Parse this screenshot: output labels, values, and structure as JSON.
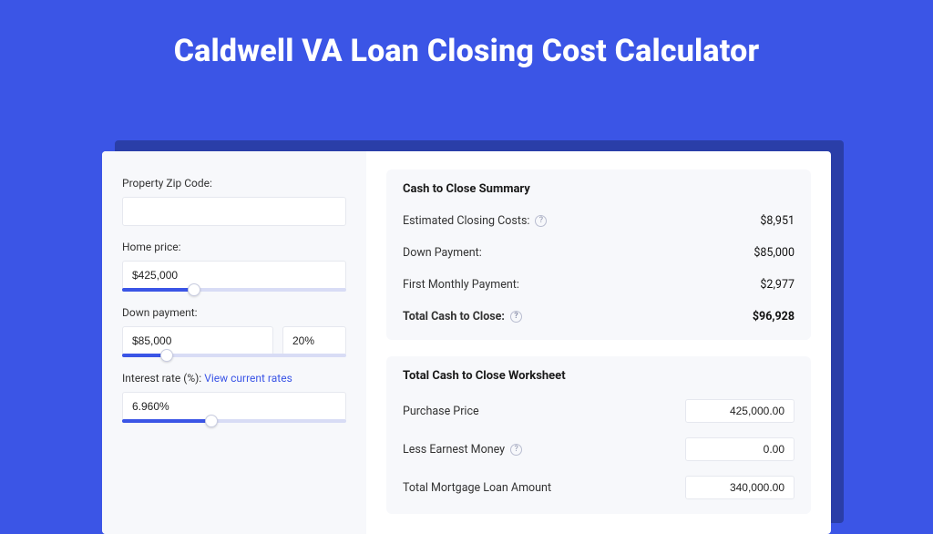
{
  "title": "Caldwell VA Loan Closing Cost Calculator",
  "sidebar": {
    "zip": {
      "label": "Property Zip Code:",
      "value": ""
    },
    "price": {
      "label": "Home price:",
      "value": "$425,000",
      "slider_pct": 32
    },
    "down": {
      "label": "Down payment:",
      "value": "$85,000",
      "pct_value": "20%",
      "slider_pct": 20
    },
    "rate": {
      "label": "Interest rate (%):",
      "link_text": "View current rates",
      "value": "6.960%",
      "slider_pct": 40
    }
  },
  "summary": {
    "title": "Cash to Close Summary",
    "rows": [
      {
        "label": "Estimated Closing Costs:",
        "help": true,
        "value": "$8,951"
      },
      {
        "label": "Down Payment:",
        "help": false,
        "value": "$85,000"
      },
      {
        "label": "First Monthly Payment:",
        "help": false,
        "value": "$2,977"
      }
    ],
    "total": {
      "label": "Total Cash to Close:",
      "help": true,
      "value": "$96,928"
    }
  },
  "worksheet": {
    "title": "Total Cash to Close Worksheet",
    "rows": [
      {
        "label": "Purchase Price",
        "help": false,
        "value": "425,000.00"
      },
      {
        "label": "Less Earnest Money",
        "help": true,
        "value": "0.00"
      },
      {
        "label": "Total Mortgage Loan Amount",
        "help": false,
        "value": "340,000.00"
      }
    ]
  }
}
